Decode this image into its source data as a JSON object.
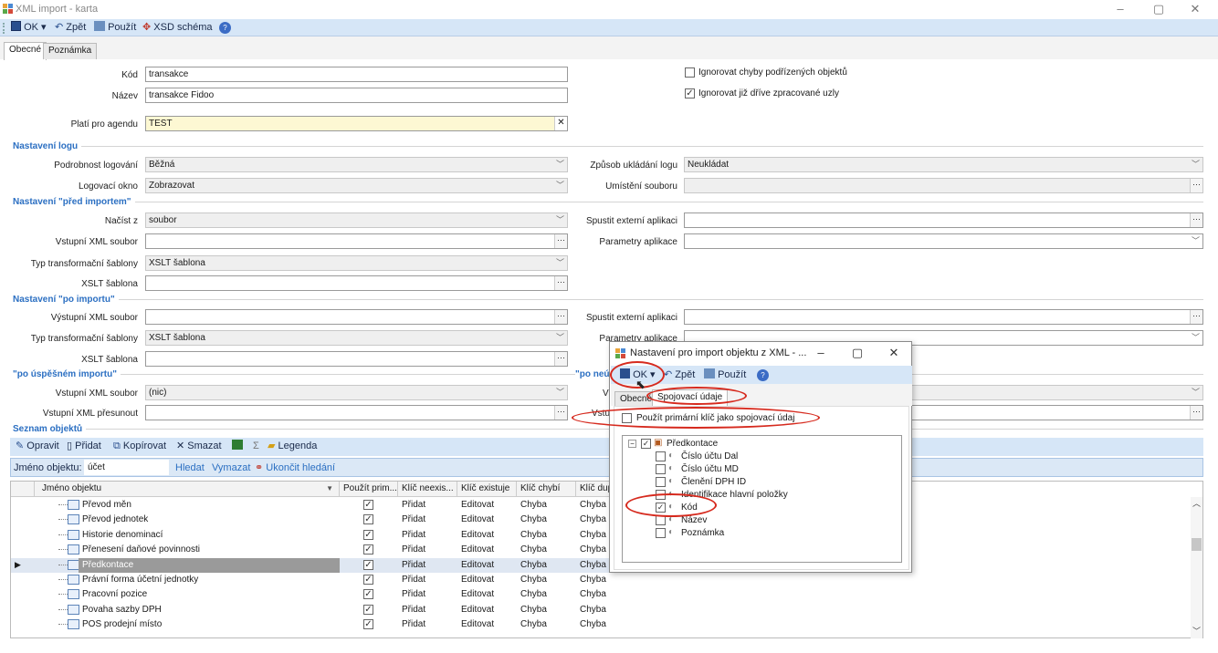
{
  "window": {
    "title": "XML import - karta",
    "minimize": "–",
    "maximize": "▢",
    "close": "✕"
  },
  "toolbar": {
    "ok": "OK",
    "back": "Zpět",
    "apply": "Použít",
    "xsd": "XSD schéma"
  },
  "tabs": [
    "Obecné",
    "Poznámka"
  ],
  "form": {
    "kod_label": "Kód",
    "kod_value": "transakce",
    "nazev_label": "Název",
    "nazev_value": "transakce Fidoo",
    "agenda_label": "Platí pro agendu",
    "agenda_value": "TEST",
    "ignore_child_errors": "Ignorovat chyby podřízených objektů",
    "ignore_processed": "Ignorovat již dříve zpracované uzly"
  },
  "log": {
    "section": "Nastavení logu",
    "detail_label": "Podrobnost logování",
    "detail_value": "Běžná",
    "window_label": "Logovací okno",
    "window_value": "Zobrazovat",
    "save_label": "Způsob ukládání logu",
    "save_value": "Neukládat",
    "location_label": "Umístění souboru"
  },
  "before": {
    "section": "Nastavení \"před importem\"",
    "load_label": "Načíst z",
    "load_value": "soubor",
    "input_label": "Vstupní XML soubor",
    "transform_label": "Typ transformační šablony",
    "transform_value": "XSLT šablona",
    "xslt_label": "XSLT šablona",
    "ext_label": "Spustit externí aplikaci",
    "params_label": "Parametry aplikace"
  },
  "after": {
    "section": "Nastavení \"po importu\"",
    "output_label": "Výstupní XML soubor",
    "transform_label": "Typ transformační šablony",
    "transform_value": "XSLT šablona",
    "xslt_label": "XSLT šablona",
    "ext_label": "Spustit externí aplikaci",
    "params_label": "Parametry aplikace"
  },
  "success": {
    "section": "\"po úspěšném importu\"",
    "out_label": "Vstupní XML soubor",
    "out_value": "(nic)",
    "move_label": "Vstupní XML přesunout",
    "fail_section_partial": "\"po neú",
    "fail_v1": "V",
    "fail_v2": "Vstu"
  },
  "objects": {
    "section": "Seznam objektů",
    "toolbar": [
      "Opravit",
      "Přidat",
      "Kopírovat",
      "Smazat",
      "Σ",
      "Legenda"
    ],
    "search_label": "Jméno objektu:",
    "search_value": "účet",
    "find": "Hledat",
    "clear": "Vymazat",
    "end_search": "Ukončit hledání",
    "columns": [
      "Jméno objektu",
      "Použít prim...",
      "Klíč neexis...",
      "Klíč existuje",
      "Klíč chybí",
      "Klíč dup"
    ],
    "rows": [
      {
        "name": "Převod měn",
        "neex": "Přidat",
        "ex": "Editovat",
        "chybi": "Chyba",
        "dup": "Chyba"
      },
      {
        "name": "Převod jednotek",
        "neex": "Přidat",
        "ex": "Editovat",
        "chybi": "Chyba",
        "dup": "Chyba"
      },
      {
        "name": "Historie denominací",
        "neex": "Přidat",
        "ex": "Editovat",
        "chybi": "Chyba",
        "dup": "Chyba"
      },
      {
        "name": "Přenesení daňové povinnosti",
        "neex": "Přidat",
        "ex": "Editovat",
        "chybi": "Chyba",
        "dup": "Chyba"
      },
      {
        "name": "Předkontace",
        "neex": "Přidat",
        "ex": "Editovat",
        "chybi": "Chyba",
        "dup": "Chyba"
      },
      {
        "name": "Právní forma účetní jednotky",
        "neex": "Přidat",
        "ex": "Editovat",
        "chybi": "Chyba",
        "dup": "Chyba"
      },
      {
        "name": "Pracovní pozice",
        "neex": "Přidat",
        "ex": "Editovat",
        "chybi": "Chyba",
        "dup": "Chyba"
      },
      {
        "name": "Povaha sazby DPH",
        "neex": "Přidat",
        "ex": "Editovat",
        "chybi": "Chyba",
        "dup": "Chyba"
      },
      {
        "name": "POS prodejní místo",
        "neex": "Přidat",
        "ex": "Editovat",
        "chybi": "Chyba",
        "dup": "Chyba"
      }
    ],
    "selected_row": 4
  },
  "dialog": {
    "title": "Nastavení pro import objektu z XML - ...",
    "ok": "OK",
    "back": "Zpět",
    "apply": "Použít",
    "tabs": [
      "Obecné",
      "Spojovací údaje"
    ],
    "use_primary_key": "Použít primární klíč jako spojovací údaj",
    "tree_root": "Předkontace",
    "tree_items": [
      {
        "label": "Číslo účtu Dal",
        "checked": false
      },
      {
        "label": "Číslo účtu MD",
        "checked": false
      },
      {
        "label": "Členění DPH ID",
        "checked": false
      },
      {
        "label": "Identifikace hlavní položky",
        "checked": false
      },
      {
        "label": "Kód",
        "checked": true
      },
      {
        "label": "Název",
        "checked": false
      },
      {
        "label": "Poznámka",
        "checked": false
      }
    ]
  },
  "colors": {
    "accent": "#2b6fc2",
    "toolbar": "#d6e6f7",
    "highlight_red": "#d62a1e",
    "selected_row": "#9a9a9a"
  }
}
